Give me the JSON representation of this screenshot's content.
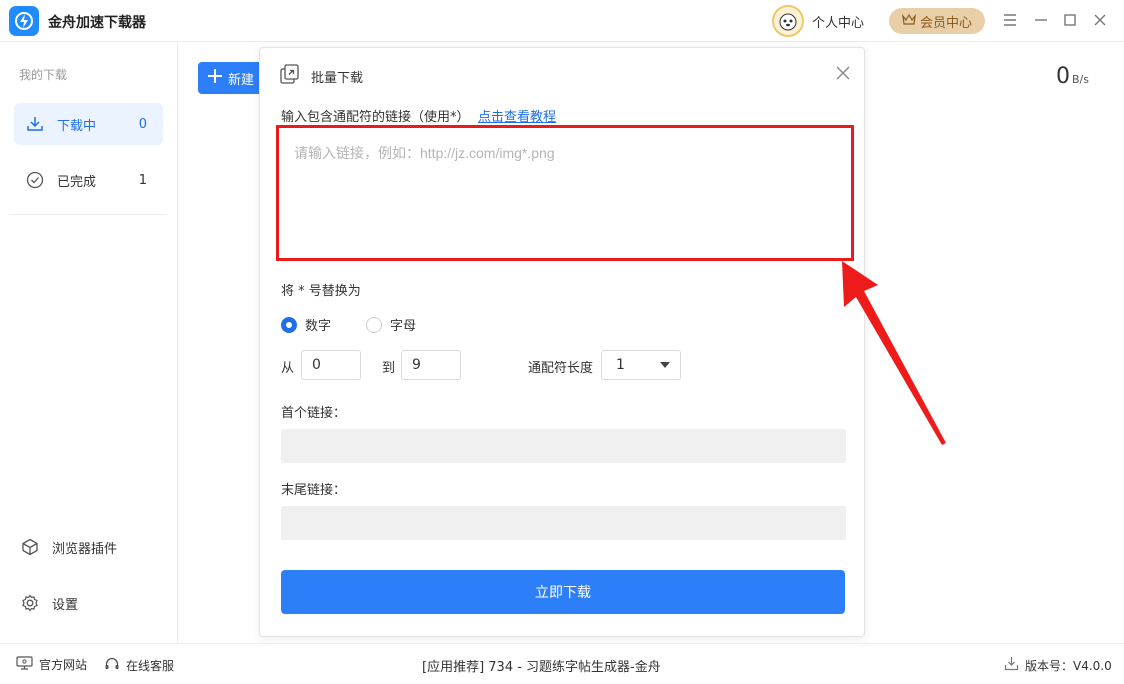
{
  "app": {
    "title": "金舟加速下载器"
  },
  "header": {
    "user_center": "个人中心",
    "vip_center": "会员中心"
  },
  "sidebar": {
    "section_title": "我的下载",
    "items": [
      {
        "label": "下载中",
        "count": "0"
      },
      {
        "label": "已完成",
        "count": "1"
      }
    ],
    "bottom": [
      {
        "label": "浏览器插件"
      },
      {
        "label": "设置"
      }
    ]
  },
  "main": {
    "new_button": "新建",
    "speed_value": "0",
    "speed_unit": "B/s"
  },
  "dialog": {
    "title": "批量下载",
    "url_label": "输入包含通配符的链接（使用*）",
    "tutorial_link": "点击查看教程",
    "url_placeholder": "请输入链接，例如：http://jz.com/img*.png",
    "replace_label": "将 * 号替换为",
    "radio_number": "数字",
    "radio_letter": "字母",
    "from_label": "从",
    "from_value": "0",
    "to_label": "到",
    "to_value": "9",
    "wildcard_len_label": "通配符长度",
    "wildcard_len_value": "1",
    "first_link_label": "首个链接：",
    "last_link_label": "末尾链接：",
    "submit": "立即下载"
  },
  "statusbar": {
    "website": "官方网站",
    "support": "在线客服",
    "recommend": "[应用推荐]   734 - 习题练字帖生成器-金舟",
    "version": "版本号：V4.0.0"
  },
  "colors": {
    "accent": "#2d7ff9",
    "highlight_border": "#e81c1c",
    "vip": "#e9cfa8"
  }
}
